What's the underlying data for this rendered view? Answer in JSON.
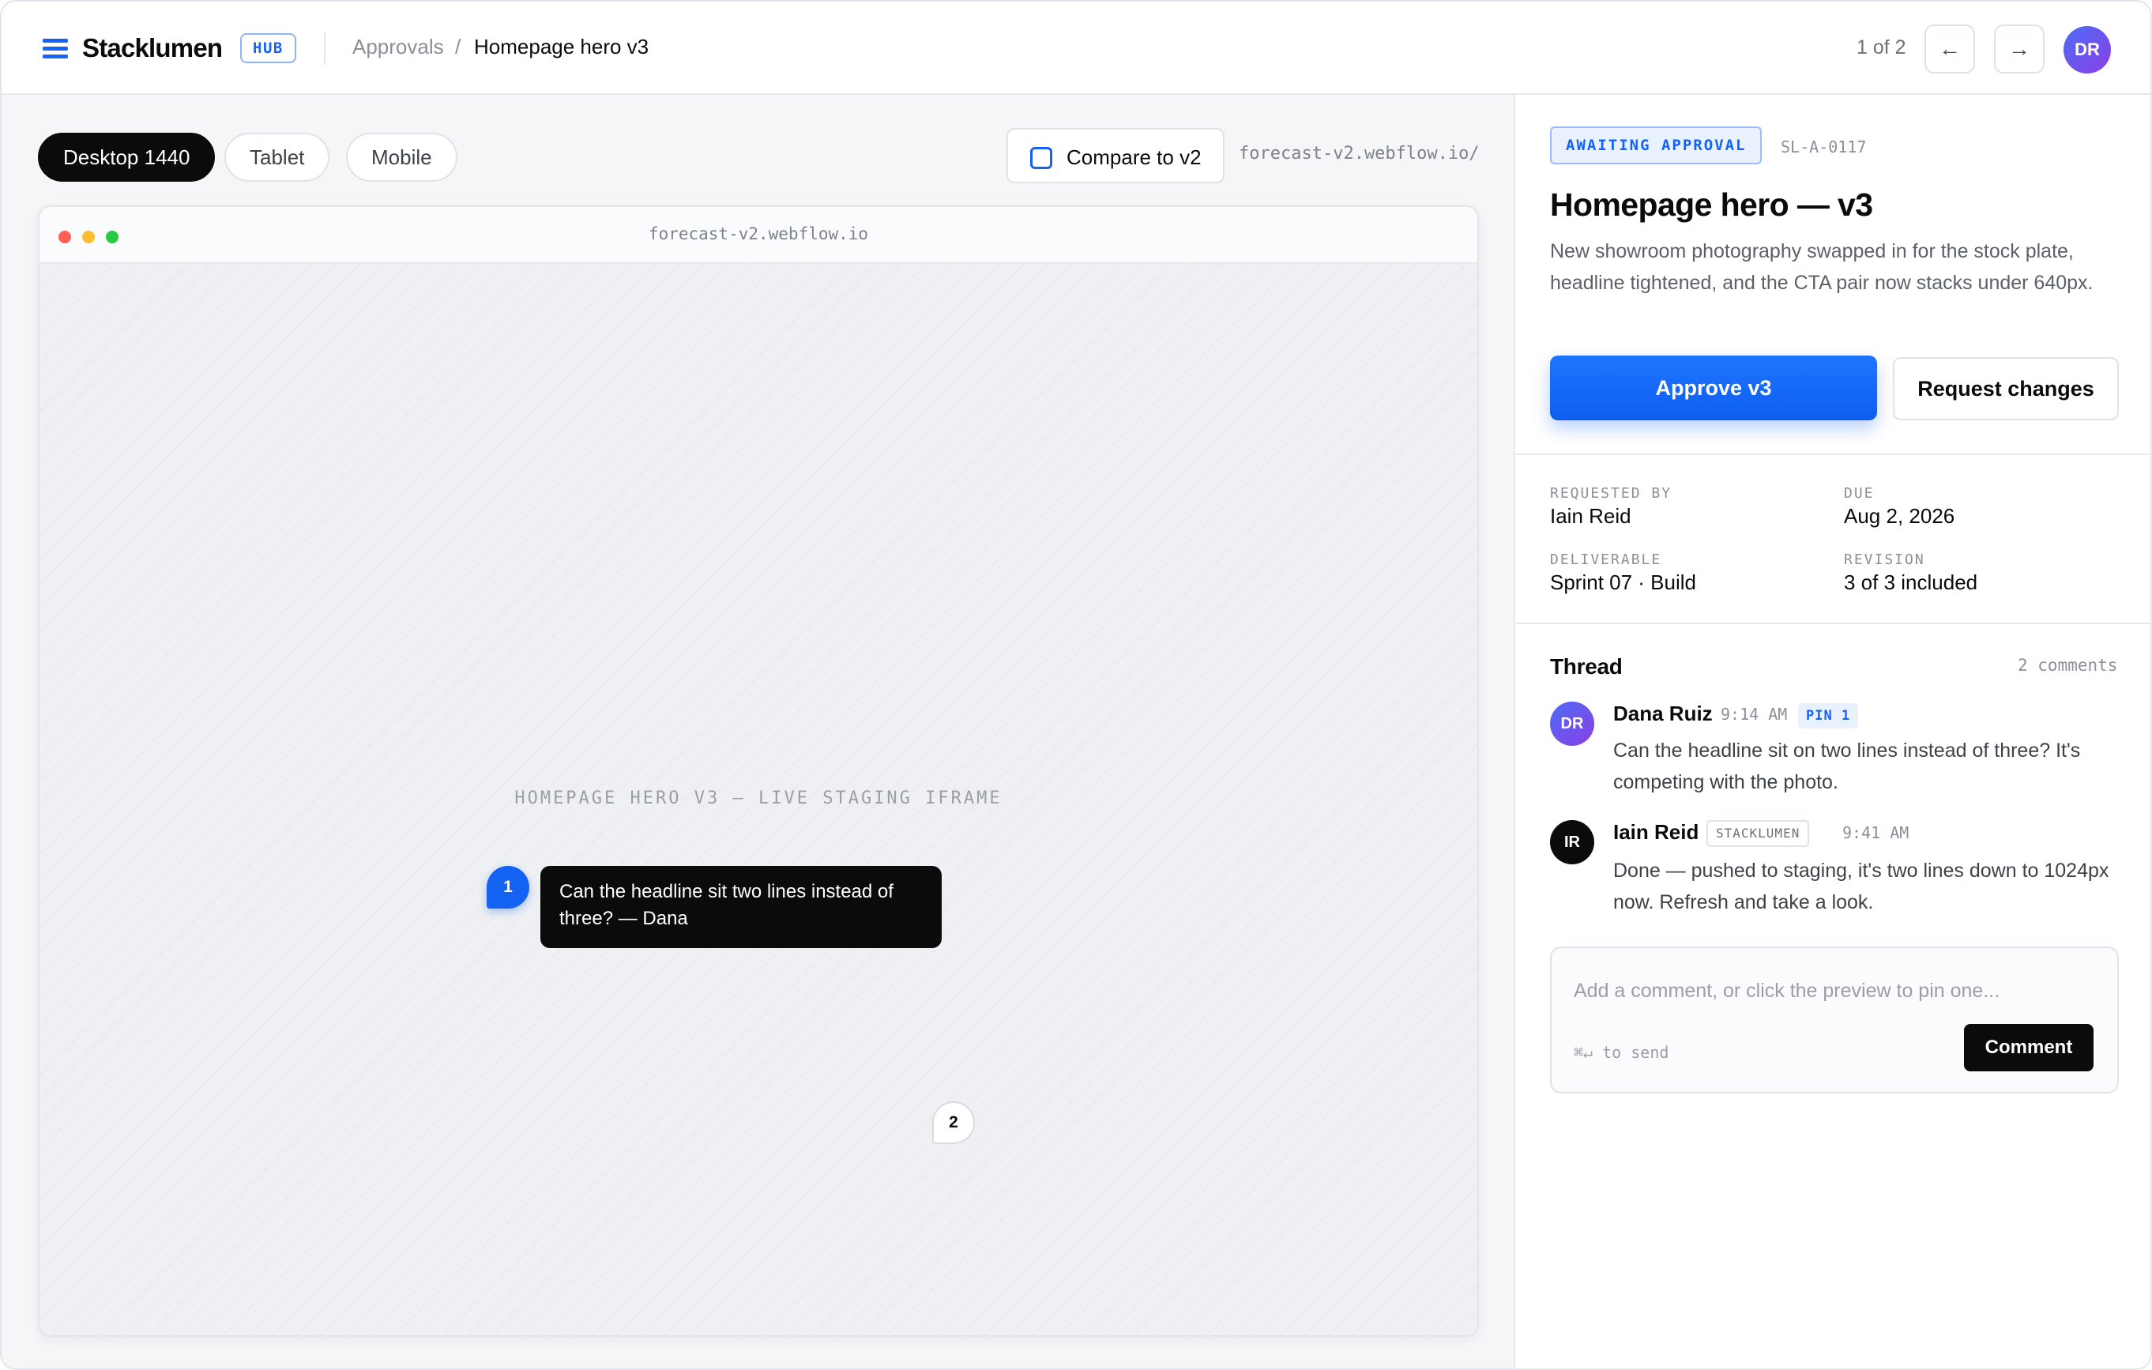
{
  "header": {
    "brand": "Stacklumen",
    "brand_badge": "HUB",
    "breadcrumb": [
      "Approvals",
      "/",
      "Homepage hero v3"
    ],
    "pager": {
      "count": "1 of 2",
      "prev_icon": "←",
      "next_icon": "→"
    },
    "user_initials": "DR"
  },
  "toolbar": {
    "viewports": [
      "Desktop 1440",
      "Tablet",
      "Mobile"
    ],
    "active_viewport": "Desktop 1440",
    "compare_label": "Compare to v2",
    "compare_checked": false,
    "url": "forecast-v2.webflow.io/"
  },
  "preview": {
    "chrome_url": "forecast-v2.webflow.io",
    "placeholder_label": "HOMEPAGE HERO V3 — LIVE STAGING IFRAME",
    "pins": [
      {
        "number": "1",
        "tooltip": "Can the headline sit two lines instead of three? — Dana"
      },
      {
        "number": "2"
      }
    ]
  },
  "detail": {
    "status": "AWAITING APPROVAL",
    "ticket_id": "SL-A-0117",
    "title": "Homepage hero — v3",
    "description": "New showroom photography swapped in for the stock plate, headline tightened, and the CTA pair now stacks under 640px.",
    "approve_label": "Approve v3",
    "request_label": "Request changes",
    "meta": {
      "requested_by_label": "REQUESTED BY",
      "requested_by": "Iain Reid",
      "due_label": "DUE",
      "due": "Aug 2, 2026",
      "deliverable_label": "DELIVERABLE",
      "deliverable": "Sprint 07 · Build",
      "revision_label": "REVISION",
      "revision": "3 of 3 included"
    }
  },
  "thread": {
    "title": "Thread",
    "count": "2 comments",
    "comments": [
      {
        "initials": "DR",
        "author": "Dana Ruiz",
        "time": "9:14 AM",
        "tag": "PIN 1",
        "body": "Can the headline sit on two lines instead of three? It's competing with the photo."
      },
      {
        "initials": "IR",
        "author": "Iain Reid",
        "tag": "STACKLUMEN",
        "time": "9:41 AM",
        "body": "Done — pushed to staging, it's two lines down to 1024px now. Refresh and take a look."
      }
    ],
    "composer": {
      "placeholder": "Add a comment, or click the preview to pin one...",
      "hint": "⌘↵ to send",
      "submit_label": "Comment"
    }
  },
  "colors": {
    "accent": "#1463f3",
    "ink": "#0b0b0c",
    "muted": "#8b8f97",
    "surface": "#f5f6f8"
  },
  "icons": {
    "menu": "hamburger-menu-icon",
    "prev": "arrow-left-icon",
    "next": "arrow-right-icon",
    "checkbox": "checkbox-icon"
  }
}
